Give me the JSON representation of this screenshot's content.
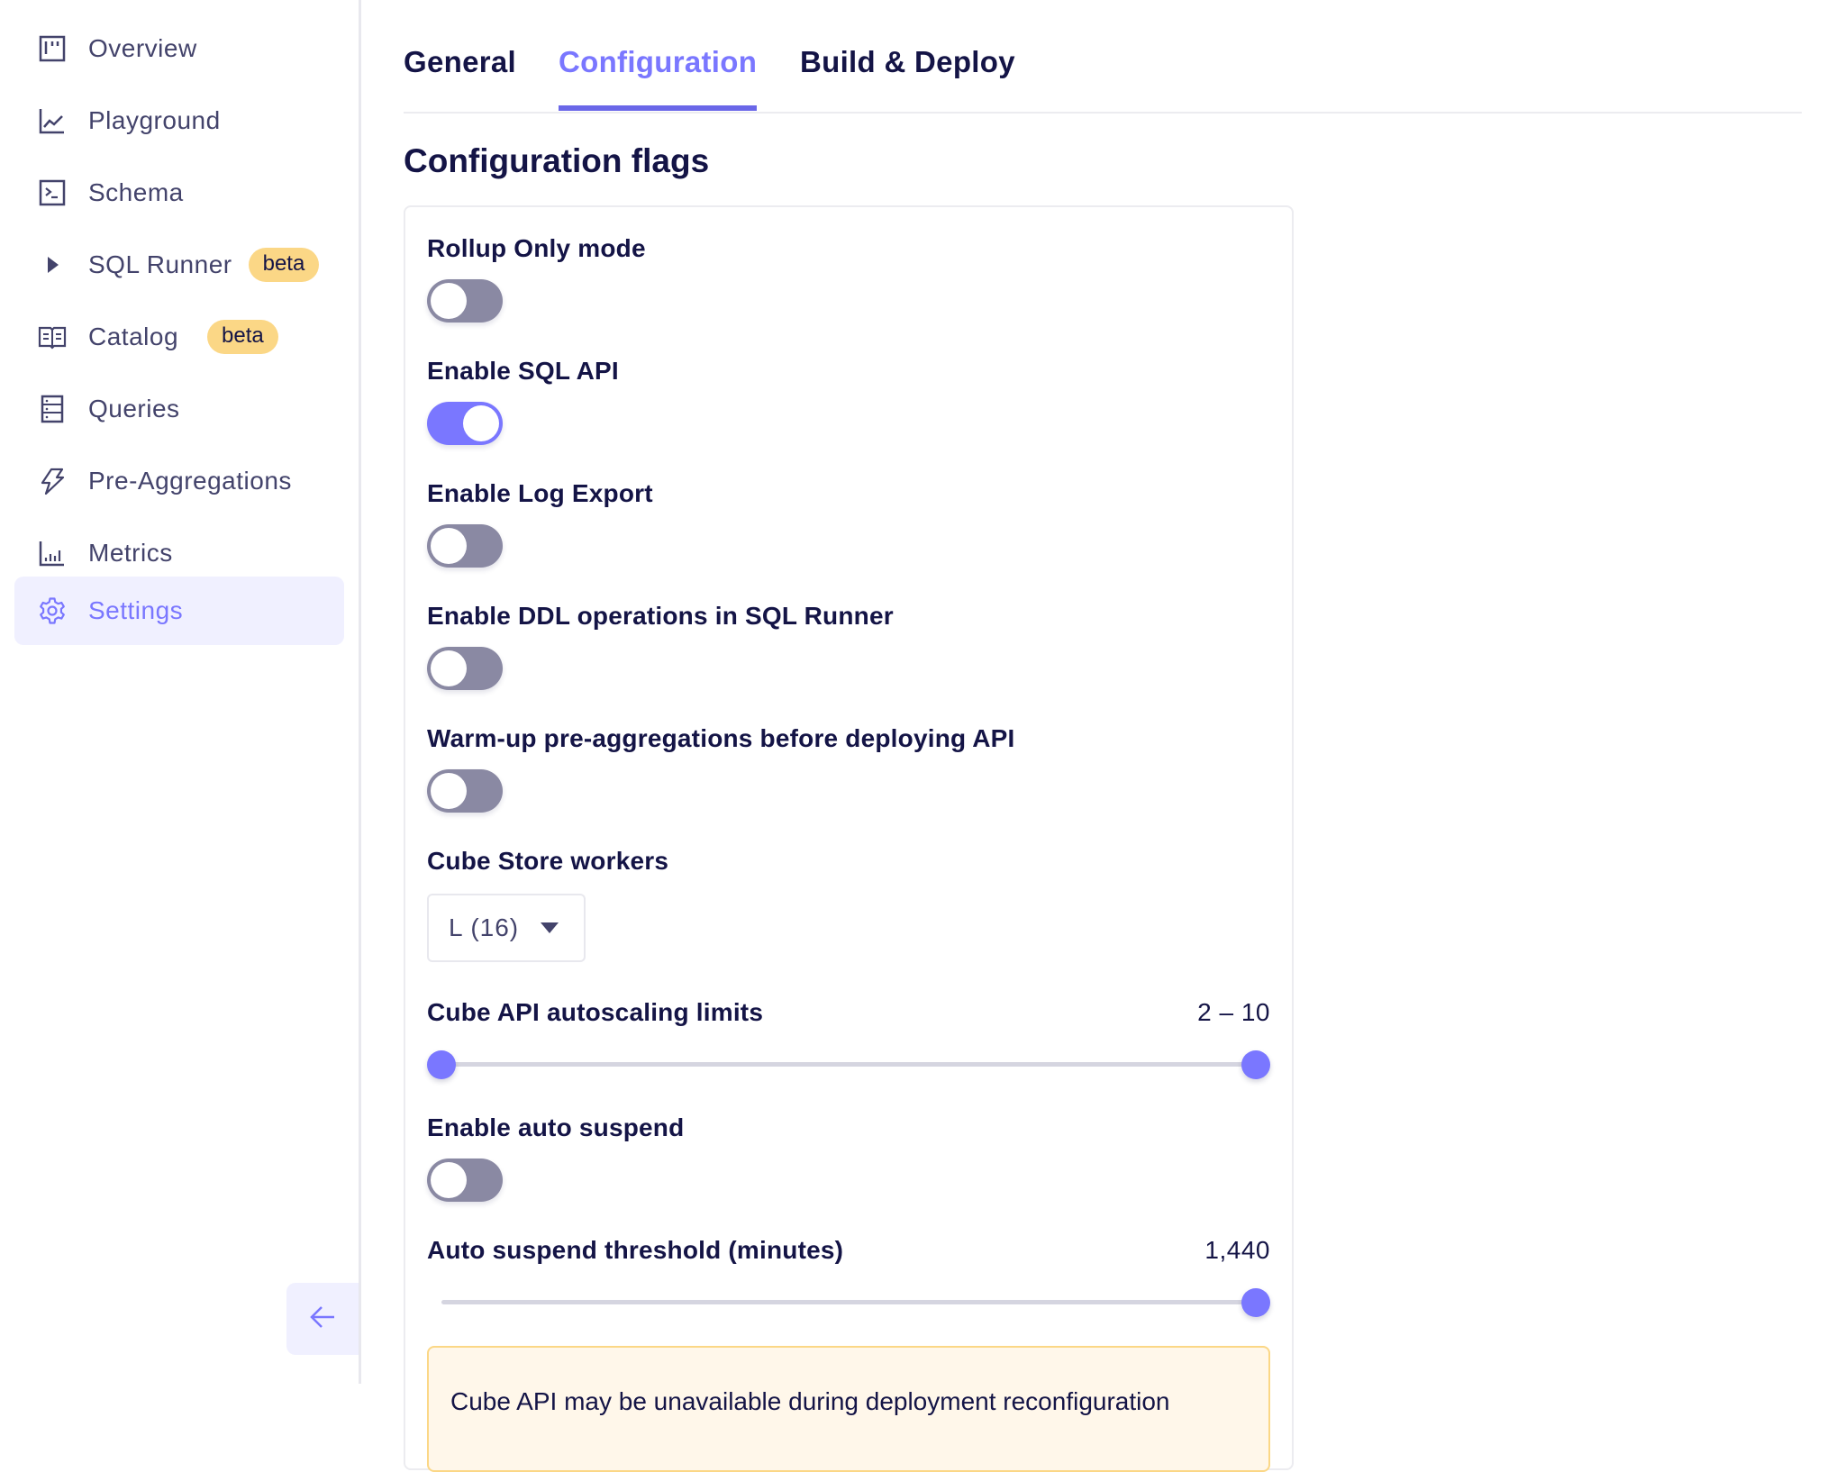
{
  "sidebar": {
    "items": [
      {
        "label": "Overview",
        "icon": "board-icon"
      },
      {
        "label": "Playground",
        "icon": "line-chart-icon"
      },
      {
        "label": "Schema",
        "icon": "terminal-icon"
      },
      {
        "label": "SQL Runner",
        "icon": "play-icon",
        "badge": "beta"
      },
      {
        "label": "Catalog",
        "icon": "book-icon",
        "badge": "beta"
      },
      {
        "label": "Queries",
        "icon": "server-icon"
      },
      {
        "label": "Pre-Aggregations",
        "icon": "lightning-icon"
      },
      {
        "label": "Metrics",
        "icon": "bar-chart-icon"
      },
      {
        "label": "Settings",
        "icon": "gear-icon",
        "active": true
      }
    ],
    "collapse_icon": "arrow-left-icon"
  },
  "tabs": [
    {
      "label": "General"
    },
    {
      "label": "Configuration",
      "active": true
    },
    {
      "label": "Build & Deploy"
    }
  ],
  "section_title": "Configuration flags",
  "flags": {
    "rollup_only": {
      "label": "Rollup Only mode",
      "enabled": false
    },
    "sql_api": {
      "label": "Enable SQL API",
      "enabled": true
    },
    "log_export": {
      "label": "Enable Log Export",
      "enabled": false
    },
    "ddl_operations": {
      "label": "Enable DDL operations in SQL Runner",
      "enabled": false
    },
    "warmup": {
      "label": "Warm-up pre-aggregations before deploying API",
      "enabled": false
    },
    "cube_store_workers": {
      "label": "Cube Store workers",
      "value": "L (16)"
    },
    "autoscaling": {
      "label": "Cube API autoscaling limits",
      "value_text": "2 – 10",
      "min": 2,
      "max": 10,
      "low_fraction": 0.0,
      "high_fraction": 1.0
    },
    "auto_suspend": {
      "label": "Enable auto suspend",
      "enabled": false
    },
    "suspend_threshold": {
      "label": "Auto suspend threshold (minutes)",
      "value_text": "1,440",
      "value": 1440,
      "fraction": 1.0
    }
  },
  "warning": {
    "text": "Cube API may be unavailable during deployment reconfiguration"
  },
  "colors": {
    "accent": "#7a77ff",
    "toggle_off": "#8a89a3",
    "badge": "#fbd786",
    "warning_bg": "#fff7ea"
  }
}
